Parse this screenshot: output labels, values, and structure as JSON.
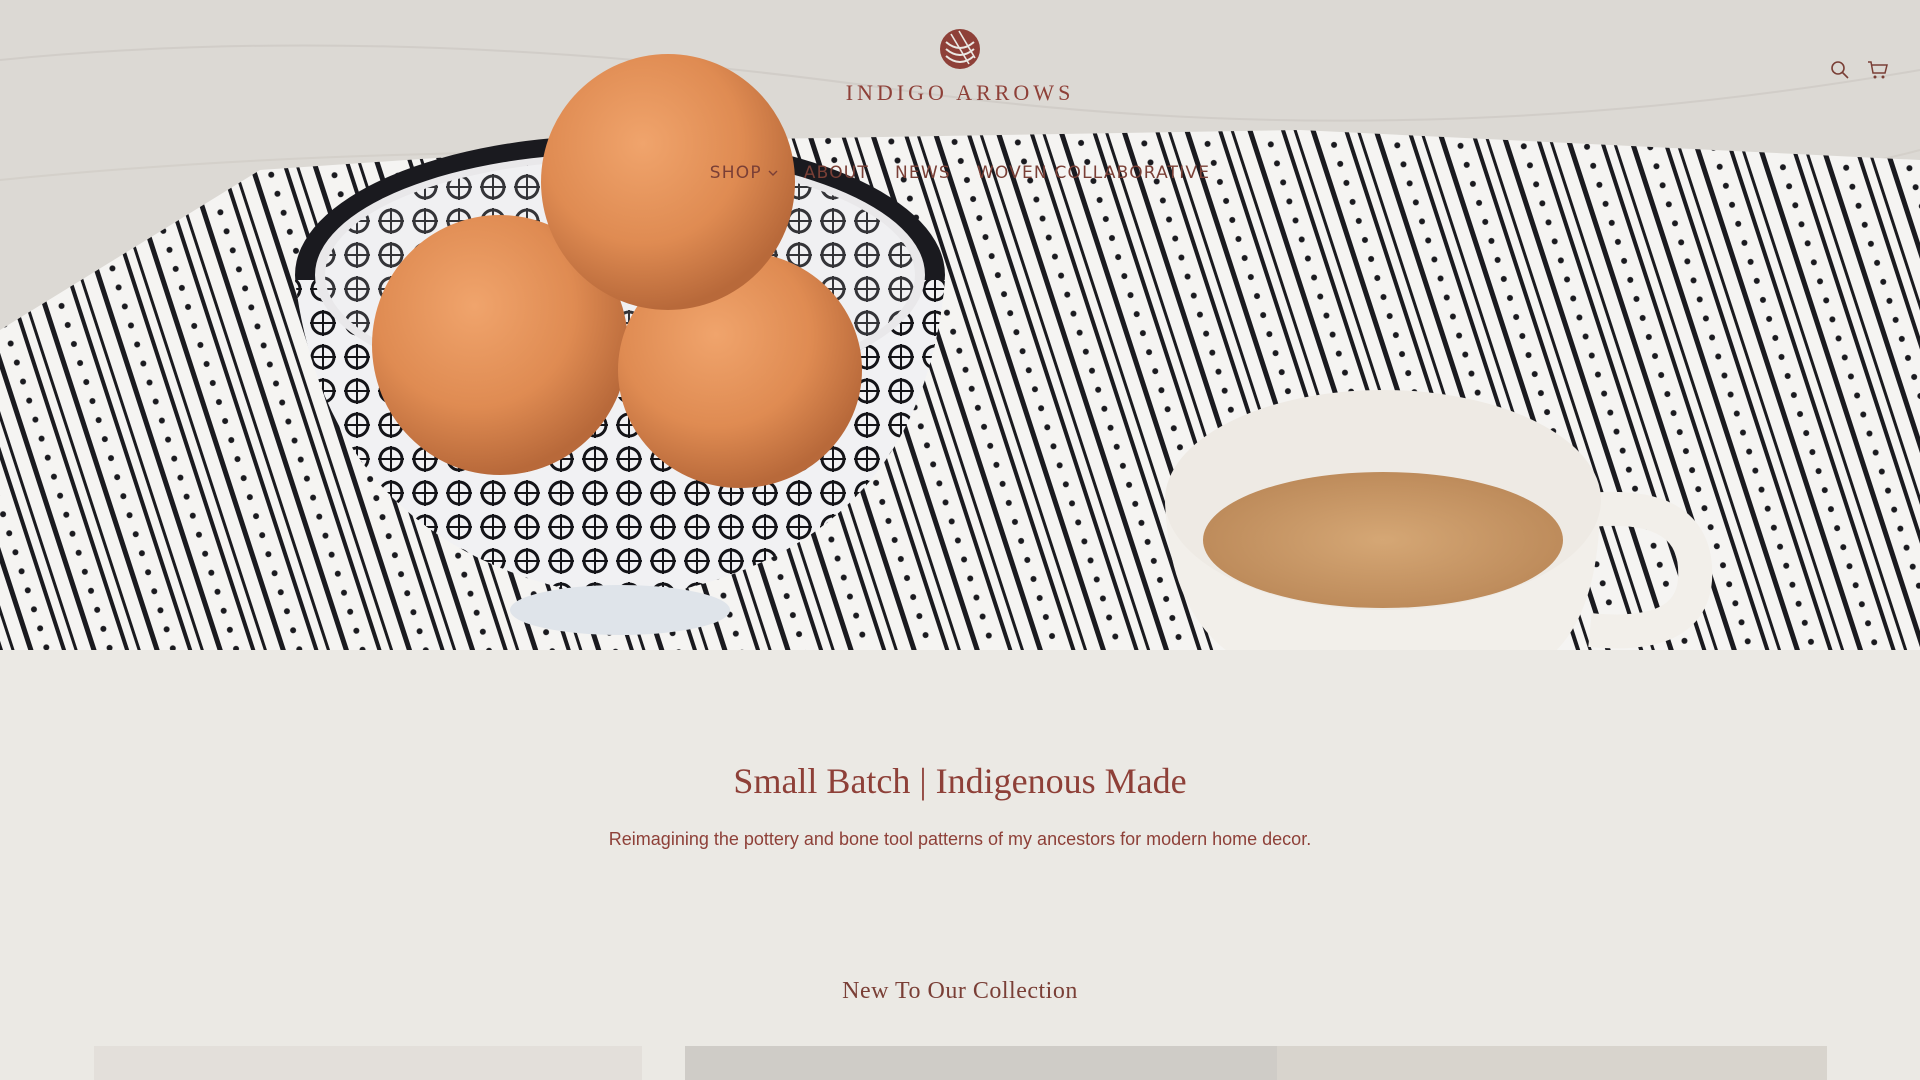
{
  "brand": {
    "name": "INDIGO ARROWS",
    "logo_icon": "woven-knot-logo",
    "color": "#8e4038"
  },
  "header": {
    "icons": [
      {
        "name": "search-icon",
        "label": "Search"
      },
      {
        "name": "cart-icon",
        "label": "Cart"
      }
    ]
  },
  "nav": {
    "items": [
      {
        "label": "SHOP",
        "has_dropdown": true
      },
      {
        "label": "ABOUT",
        "has_dropdown": false
      },
      {
        "label": "NEWS",
        "has_dropdown": false
      },
      {
        "label": "WOVEN COLLABORATIVE",
        "has_dropdown": false
      }
    ]
  },
  "intro": {
    "title": "Small Batch | Indigenous Made",
    "subtitle": "Reimagining the pottery and bone tool patterns of my ancestors for modern home decor."
  },
  "collection": {
    "title": "New To Our Collection"
  },
  "colors": {
    "background": "#ebe9e4",
    "accent": "#8e4038",
    "egg": "#df8b52",
    "tea": "#c99a6a"
  }
}
